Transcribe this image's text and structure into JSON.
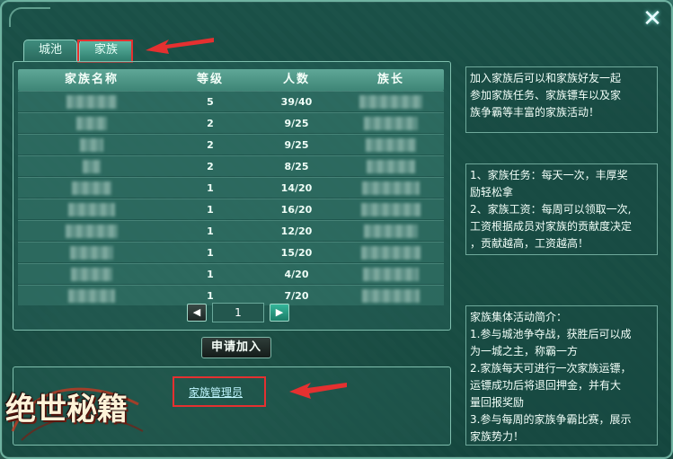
{
  "tabs": [
    {
      "label": "城池"
    },
    {
      "label": "家族"
    }
  ],
  "close_glyph": "✕",
  "table": {
    "headers": [
      "家族名称",
      "等级",
      "人数",
      "族长"
    ],
    "rows": [
      {
        "level": "5",
        "members": "39/40"
      },
      {
        "level": "2",
        "members": "9/25"
      },
      {
        "level": "2",
        "members": "9/25"
      },
      {
        "level": "2",
        "members": "8/25"
      },
      {
        "level": "1",
        "members": "14/20"
      },
      {
        "level": "1",
        "members": "16/20"
      },
      {
        "level": "1",
        "members": "12/20"
      },
      {
        "level": "1",
        "members": "15/20"
      },
      {
        "level": "1",
        "members": "4/20"
      },
      {
        "level": "1",
        "members": "7/20"
      }
    ]
  },
  "pager": {
    "prev_icon": "◀",
    "page": "1",
    "next_icon": "▶"
  },
  "apply_button": "申请加入",
  "bottom_panel": {
    "manager_link": "家族管理员"
  },
  "info_box_1": {
    "lines": [
      "加入家族后可以和家族好友一起",
      "参加家族任务、家族镖车以及家",
      "族争霸等丰富的家族活动！"
    ]
  },
  "info_box_2": {
    "lines": [
      "1、家族任务：每天一次，丰厚奖",
      "励轻松拿",
      "2、家族工资：每周可以领取一次,",
      "工资根据成员对家族的贡献度决定",
      "，贡献越高，工资越高！"
    ]
  },
  "info_box_3": {
    "lines": [
      "家族集体活动简介：",
      "1.参与城池争夺战，获胜后可以成",
      "为一城之主，称霸一方",
      "2.家族每天可进行一次家族运镖，",
      "运镖成功后将退回押金，并有大",
      "量回报奖励",
      "3.参与每周的家族争霸比赛，展示",
      "家族势力！"
    ]
  },
  "logo_text": "绝世秘籍",
  "colors": {
    "highlight": "#e53030",
    "panel_border": "#7fbfae",
    "header_bg": "#5fa797"
  }
}
